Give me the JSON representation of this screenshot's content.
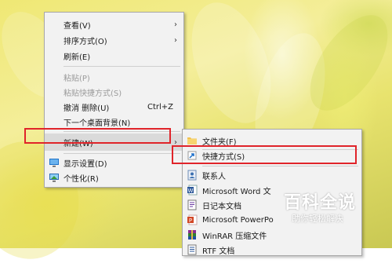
{
  "context_menu": {
    "items": [
      {
        "label": "查看(V)",
        "has_submenu": true,
        "enabled": true
      },
      {
        "label": "排序方式(O)",
        "has_submenu": true,
        "enabled": true
      },
      {
        "label": "刷新(E)",
        "enabled": true
      },
      {
        "label": "粘贴(P)",
        "enabled": false
      },
      {
        "label": "粘贴快捷方式(S)",
        "enabled": false
      },
      {
        "label": "撤消 删除(U)",
        "accelerator": "Ctrl+Z",
        "enabled": true
      },
      {
        "label": "下一个桌面背景(N)",
        "enabled": true
      },
      {
        "label": "新建(W)",
        "has_submenu": true,
        "enabled": true,
        "highlighted": true
      },
      {
        "label": "显示设置(D)",
        "icon": "display-settings-icon",
        "enabled": true
      },
      {
        "label": "个性化(R)",
        "icon": "personalize-icon",
        "enabled": true
      }
    ]
  },
  "new_submenu": {
    "items": [
      {
        "label": "文件夹(F)",
        "icon": "folder-icon"
      },
      {
        "label": "快捷方式(S)",
        "icon": "shortcut-icon"
      },
      {
        "label": "联系人",
        "icon": "contact-icon"
      },
      {
        "label": "Microsoft Word 文",
        "icon": "word-doc-icon"
      },
      {
        "label": "日记本文档",
        "icon": "journal-icon"
      },
      {
        "label": "Microsoft PowerPo",
        "icon": "powerpoint-icon"
      },
      {
        "label": "WinRAR 压缩文件",
        "icon": "winrar-icon"
      },
      {
        "label": "RTF 文档",
        "icon": "rtf-icon"
      }
    ]
  },
  "watermark": {
    "title": "百科全说",
    "subtitle": "助你轻松解决"
  },
  "colors": {
    "highlight_box": "#e0242a",
    "menu_bg": "#f2f2f2"
  }
}
